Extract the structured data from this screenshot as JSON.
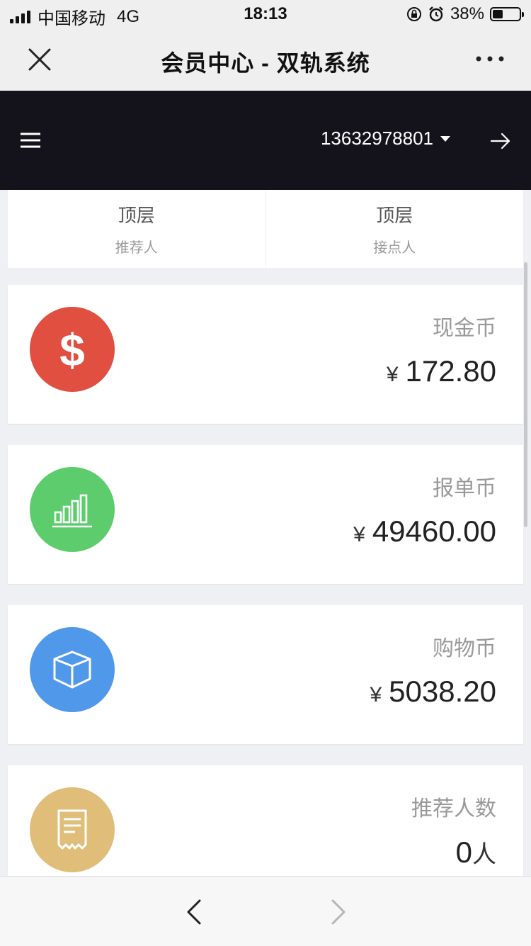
{
  "status_bar": {
    "carrier": "中国移动",
    "network": "4G",
    "time": "18:13",
    "battery": "38%",
    "battery_level": 0.38
  },
  "title_bar": {
    "title": "会员中心 - 双轨系统"
  },
  "header": {
    "account": "13632978801"
  },
  "upline": [
    {
      "value": "顶层",
      "label": "推荐人"
    },
    {
      "value": "顶层",
      "label": "接点人"
    }
  ],
  "wallets": [
    {
      "label": "现金币",
      "currency": "¥",
      "amount": "172.80",
      "icon": "dollar-icon",
      "color": "#e04f3f"
    },
    {
      "label": "报单币",
      "currency": "¥",
      "amount": "49460.00",
      "icon": "bar-chart-icon",
      "color": "#5ccc6c"
    },
    {
      "label": "购物币",
      "currency": "¥",
      "amount": "5038.20",
      "icon": "box-icon",
      "color": "#4f98ea"
    },
    {
      "label": "推荐人数",
      "amount": "0",
      "unit": "人",
      "icon": "receipt-icon",
      "color": "#e0bd78"
    }
  ]
}
